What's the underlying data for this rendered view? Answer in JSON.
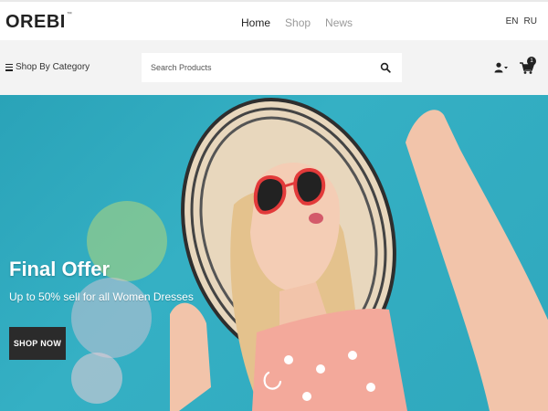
{
  "header": {
    "logo": "OREBI",
    "logo_mark": "™",
    "nav": [
      "Home",
      "Shop",
      "News"
    ],
    "active_nav": "Home",
    "languages": [
      "EN",
      "RU"
    ]
  },
  "searchbar": {
    "category_label": "Shop By Category",
    "search_placeholder": "Search Products",
    "cart_count": "1",
    "icons": [
      "menu-icon",
      "search-icon",
      "user-icon",
      "cart-icon"
    ]
  },
  "hero": {
    "title": "Final Offer",
    "subtitle": "Up to 50% sell for all Women Dresses",
    "cta": "SHOP NOW"
  },
  "colors": {
    "hero_bg": "#2fa8bd",
    "button_bg": "#2b2b2b",
    "accent_circle_green": "#b4d778"
  }
}
